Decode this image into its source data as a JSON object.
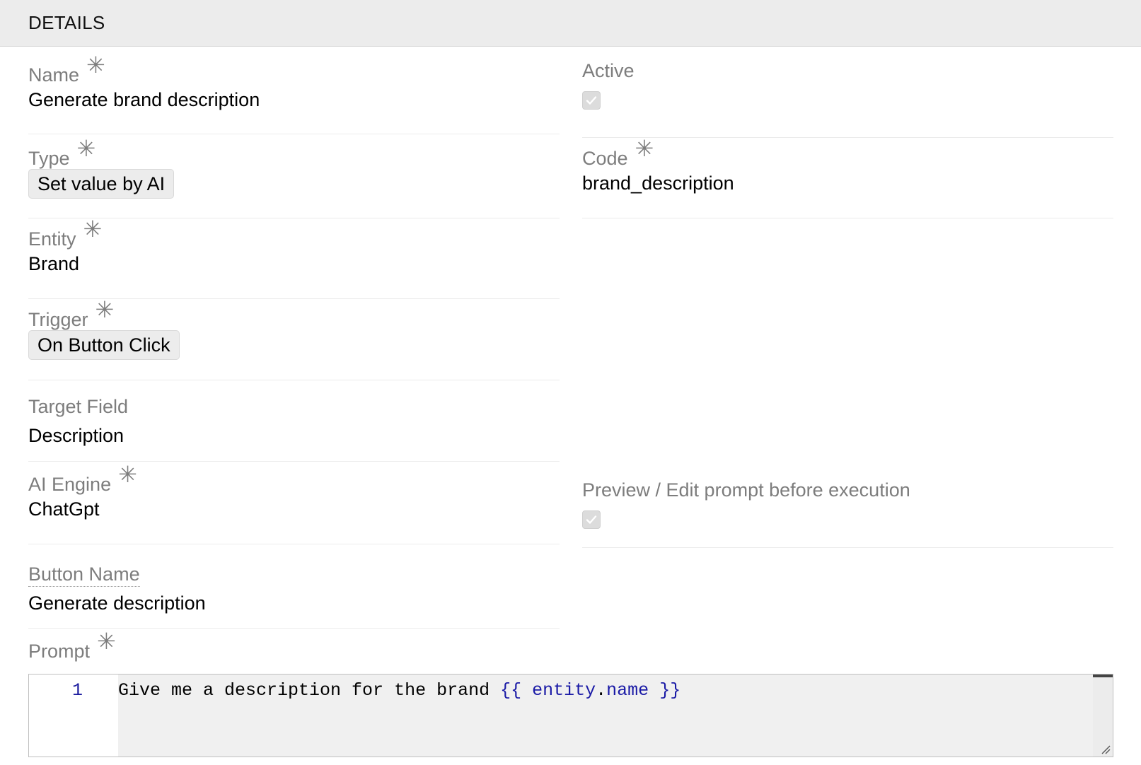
{
  "header": {
    "title": "DETAILS"
  },
  "fields": {
    "name": {
      "label": "Name",
      "required": "✳",
      "value": "Generate brand description"
    },
    "active": {
      "label": "Active",
      "checked": true
    },
    "type": {
      "label": "Type",
      "required": "✳",
      "value": "Set value by AI"
    },
    "code": {
      "label": "Code",
      "required": "✳",
      "value": "brand_description"
    },
    "entity": {
      "label": "Entity",
      "required": "✳",
      "value": "Brand"
    },
    "trigger": {
      "label": "Trigger",
      "required": "✳",
      "value": "On Button Click"
    },
    "target_field": {
      "label": "Target Field",
      "value": "Description"
    },
    "ai_engine": {
      "label": "AI Engine",
      "required": "✳",
      "value": "ChatGpt"
    },
    "preview_edit": {
      "label": "Preview / Edit prompt before execution",
      "checked": true
    },
    "button_name": {
      "label": "Button Name",
      "value": "Generate description"
    },
    "prompt": {
      "label": "Prompt",
      "required": "✳",
      "line_number": "1",
      "text_prefix": "Give me a description for the brand ",
      "open_brace": "{{",
      "var_object": "entity",
      "dot": ".",
      "var_property": "name",
      "close_brace": "}}"
    }
  },
  "icons": {
    "checkmark": "checkmark-icon",
    "required": "asterisk-icon",
    "resize": "resize-handle-icon"
  }
}
